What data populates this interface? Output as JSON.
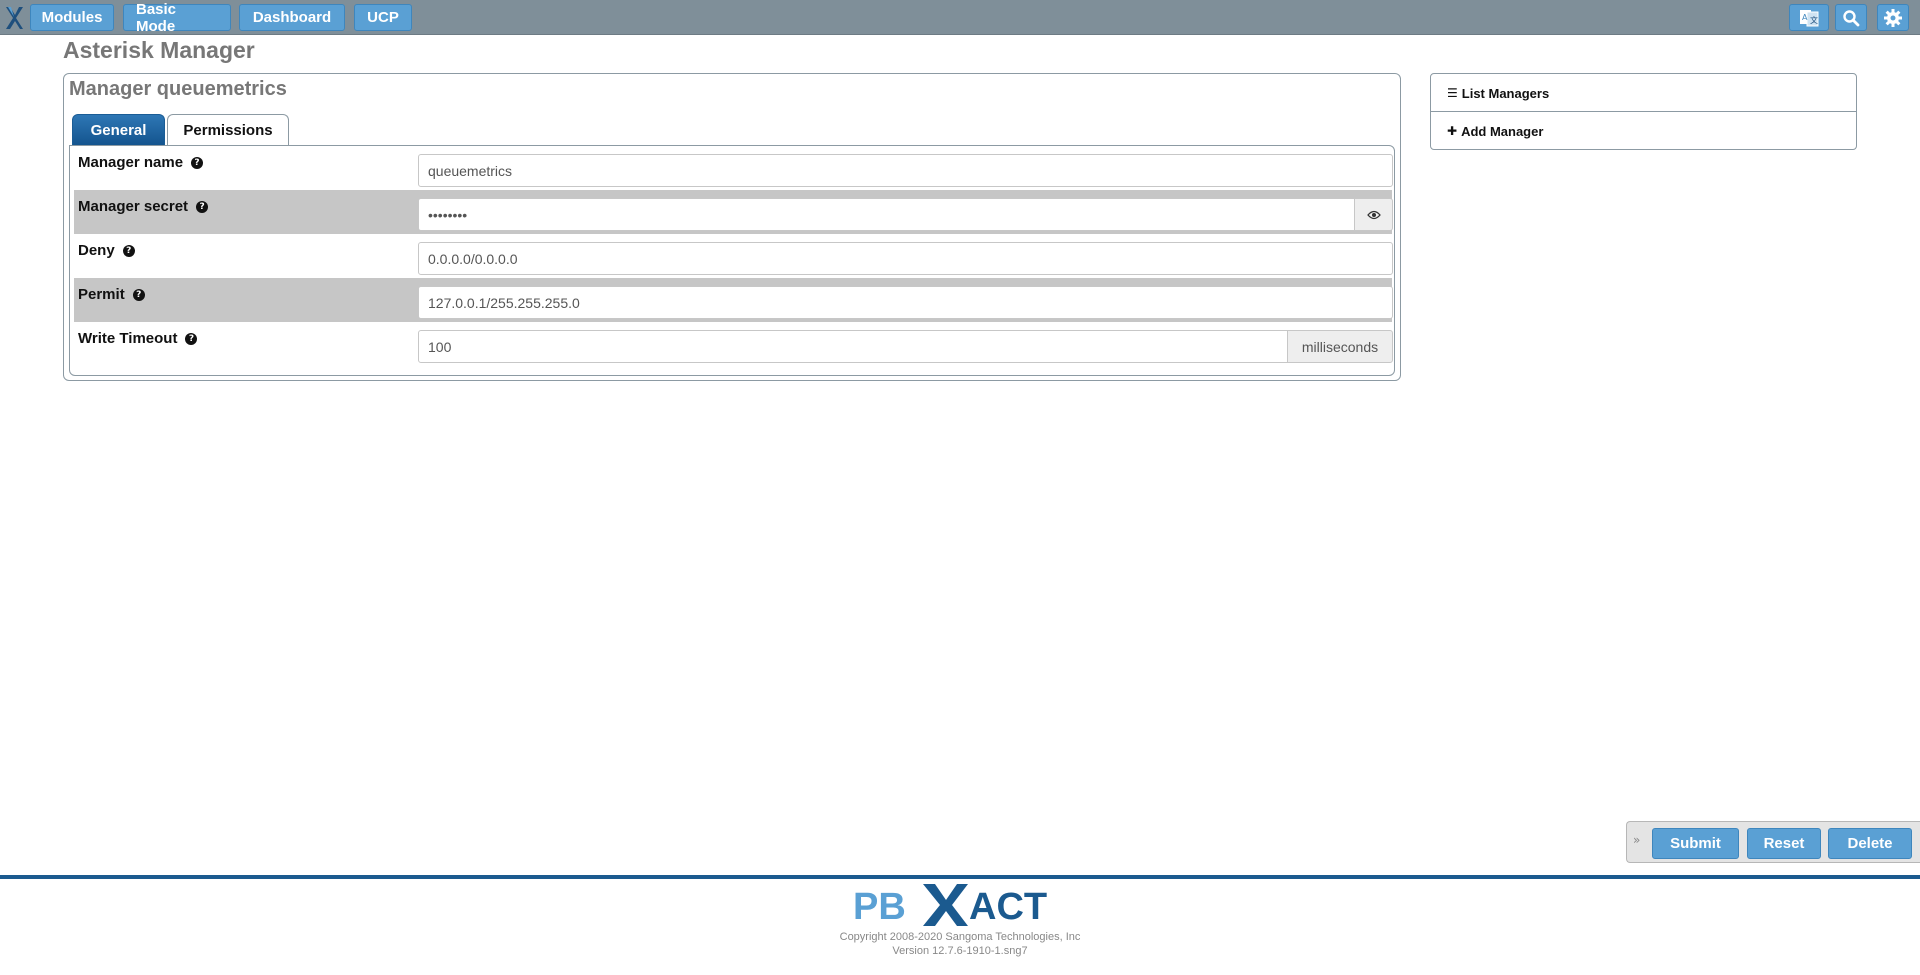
{
  "topbar": {
    "nav": [
      "Modules",
      "Basic Mode",
      "Dashboard",
      "UCP"
    ],
    "icons": [
      "translate-icon",
      "search-icon",
      "gear-icon"
    ]
  },
  "page": {
    "title": "Asterisk Manager"
  },
  "panel": {
    "title": "Manager queuemetrics",
    "tabs": [
      {
        "label": "General",
        "active": true
      },
      {
        "label": "Permissions",
        "active": false
      }
    ],
    "fields": {
      "name": {
        "label": "Manager name",
        "value": "queuemetrics"
      },
      "secret": {
        "label": "Manager secret",
        "value": "••••••••"
      },
      "deny": {
        "label": "Deny",
        "value": "0.0.0.0/0.0.0.0"
      },
      "permit": {
        "label": "Permit",
        "value": "127.0.0.1/255.255.255.0"
      },
      "timeout": {
        "label": "Write Timeout",
        "value": "100",
        "unit": "milliseconds"
      }
    }
  },
  "side": {
    "list": "List Managers",
    "add": "Add Manager"
  },
  "actions": {
    "submit": "Submit",
    "reset": "Reset",
    "delete": "Delete"
  },
  "footer": {
    "logo_left": "PB",
    "logo_right": "ACT",
    "copyright": "Copyright 2008-2020 Sangoma Technologies, Inc",
    "version": "Version 12.7.6-1910-1.sng7"
  },
  "colors": {
    "topbar": "#7f8f99",
    "button": "#5aa0d4",
    "active_tab": "#1f65a3",
    "footer_line": "#1b5a8f"
  }
}
